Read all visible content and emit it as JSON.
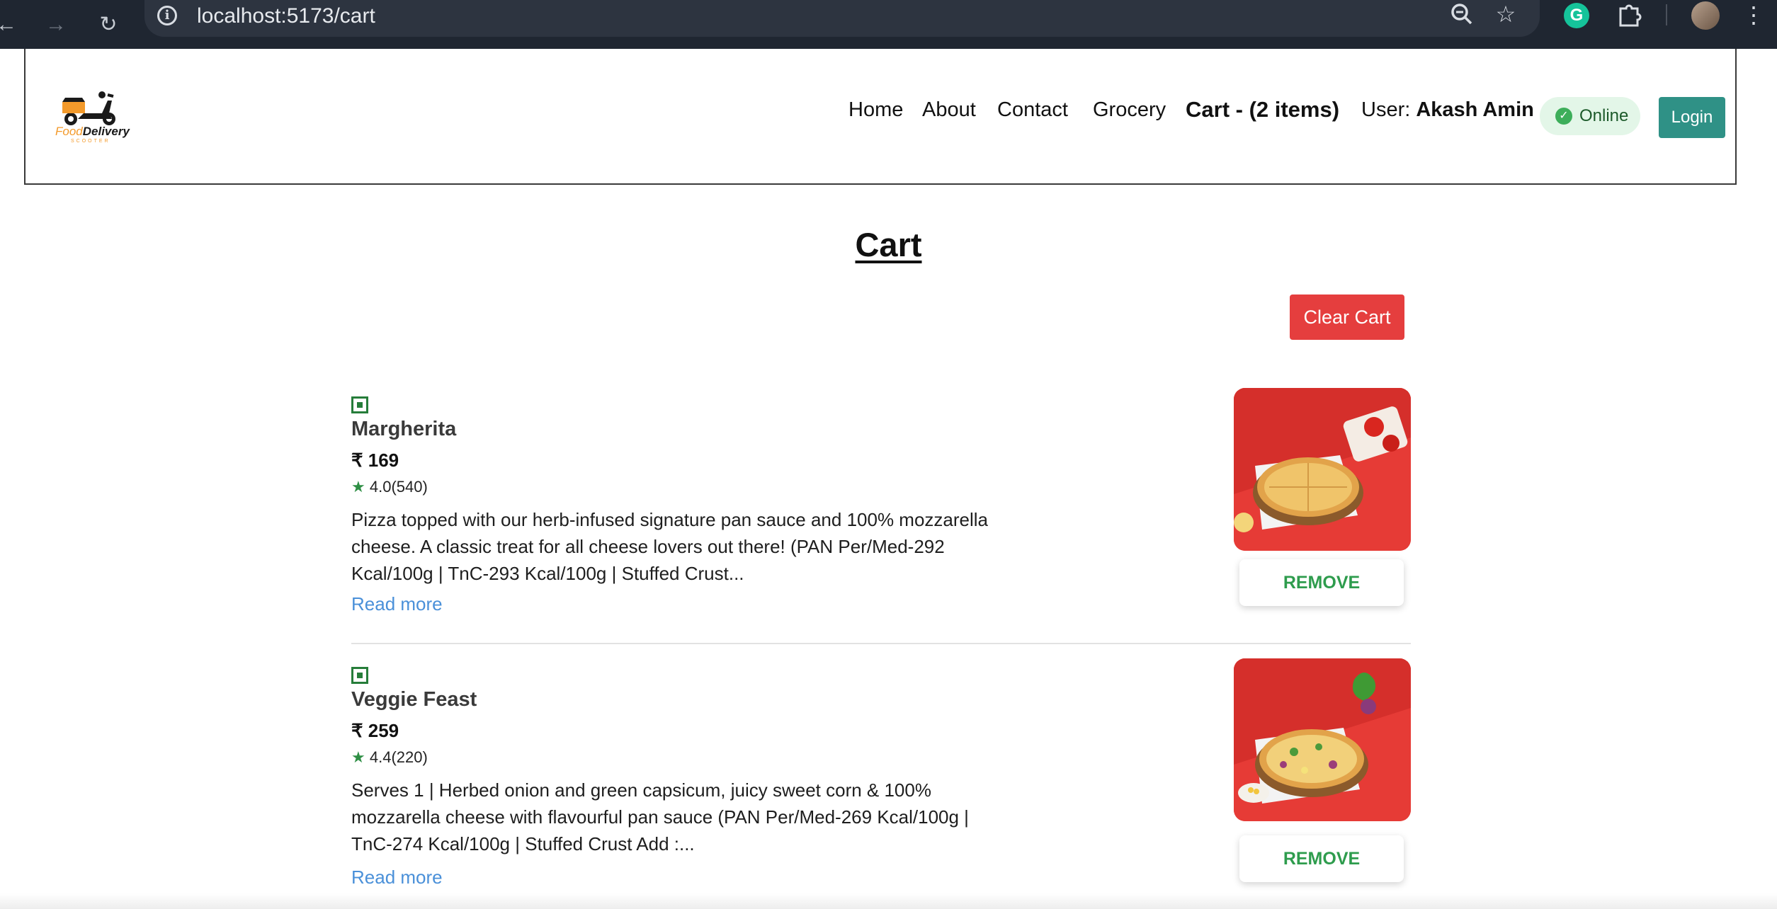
{
  "browser": {
    "url": "localhost:5173/cart",
    "back_icon": "arrow-left-icon",
    "forward_icon": "arrow-right-icon",
    "reload_icon": "reload-icon"
  },
  "header": {
    "logo": {
      "food": "Food",
      "delivery": "Delivery",
      "tagline": "SCOOTER"
    },
    "nav": {
      "home": "Home",
      "about": "About",
      "contact": "Contact",
      "grocery": "Grocery",
      "cart": "Cart - (2 items)"
    },
    "user_prefix": "User: ",
    "user_name": "Akash Amin",
    "status_label": "Online",
    "login_label": "Login"
  },
  "page": {
    "title": "Cart",
    "clear_label": "Clear Cart"
  },
  "items": [
    {
      "name": "Margherita",
      "price": "₹ 169",
      "rating": "4.0(540)",
      "description": "Pizza topped with our herb-infused signature pan sauce and 100% mozzarella cheese. A classic treat for all cheese lovers out there! (PAN Per/Med-292 Kcal/100g | TnC-293 Kcal/100g | Stuffed Crust...",
      "read_more": "Read more",
      "remove_label": "REMOVE"
    },
    {
      "name": "Veggie Feast",
      "price": "₹ 259",
      "rating": "4.4(220)",
      "description": "Serves 1 | Herbed onion and green capsicum, juicy sweet corn & 100% mozzarella cheese with flavourful pan sauce (PAN Per/Med-269 Kcal/100g | TnC-274 Kcal/100g | Stuffed Crust Add :...",
      "read_more": "Read more",
      "remove_label": "REMOVE"
    }
  ],
  "colors": {
    "clear_button": "#e53e3e",
    "login_button": "#2f9186",
    "veg_mark": "#267d3a",
    "remove_text": "#2e9c4d",
    "read_more": "#4a90d9"
  }
}
